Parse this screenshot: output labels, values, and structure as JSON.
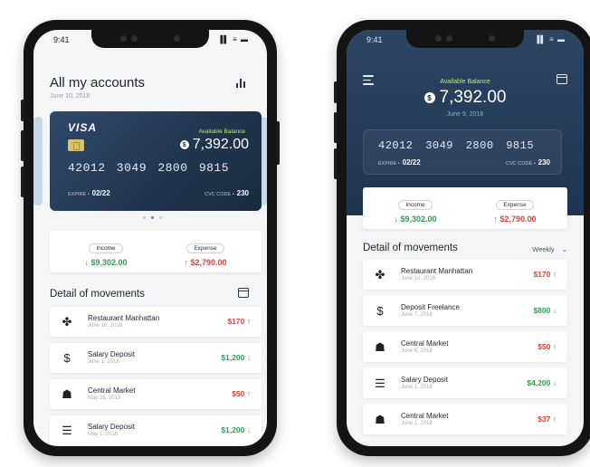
{
  "left_phone": {
    "status_time": "9:41",
    "status_icons": "▐▌ ≡ ▬",
    "title": "All my accounts",
    "date": "June 10, 2018",
    "card": {
      "brand": "VISA",
      "available_label": "Available Balance",
      "currency_symbol": "$",
      "balance": "7,392.00",
      "number": "42012 3049 2800 9815",
      "expire_label": "EXPIRE •",
      "expire_value": "02/22",
      "cvc_label": "CVC CODE •",
      "cvc_value": "230"
    },
    "income_label": "Income",
    "income_value": "$9,302.00",
    "expense_label": "Expense",
    "expense_value": "$2,790.00",
    "section_title": "Detail of movements",
    "movements": [
      {
        "name": "Restaurant Manhattan",
        "date": "June 10, 2018",
        "amount": "$170",
        "arrow": "↑",
        "type": "out",
        "icon": "restaurant-icon",
        "glyph": "✤"
      },
      {
        "name": "Salary Deposit",
        "date": "June 1, 2018",
        "amount": "$1,200",
        "arrow": "↓",
        "type": "in",
        "icon": "money-hand-icon",
        "glyph": "$"
      },
      {
        "name": "Central Market",
        "date": "May 28, 2018",
        "amount": "$50",
        "arrow": "↑",
        "type": "out",
        "icon": "shopping-bag-icon",
        "glyph": "☗"
      },
      {
        "name": "Salary Deposit",
        "date": "May 1, 2018",
        "amount": "$1,200",
        "arrow": "↓",
        "type": "in",
        "icon": "cash-stack-icon",
        "glyph": "☰"
      }
    ]
  },
  "right_phone": {
    "status_time": "9:41",
    "status_icons": "▐▌ ≡ ▬",
    "available_label": "Available Balance",
    "currency_symbol": "$",
    "balance": "7,392.00",
    "date": "June 9, 2018",
    "card": {
      "number": "42012 3049 2800 9815",
      "expire_label": "EXPIRE •",
      "expire_value": "02/22",
      "cvc_label": "CVC CODE •",
      "cvc_value": "230"
    },
    "income_label": "Income",
    "income_value": "$9,302.00",
    "expense_label": "Expense",
    "expense_value": "$2,790.00",
    "section_title": "Detail of movements",
    "filter_value": "Weekly",
    "movements": [
      {
        "name": "Restaurant Manhattan",
        "date": "June 10, 2018",
        "amount": "$170",
        "arrow": "↑",
        "type": "out",
        "icon": "restaurant-icon",
        "glyph": "✤"
      },
      {
        "name": "Deposit Freelance",
        "date": "June 7, 2018",
        "amount": "$800",
        "arrow": "↓",
        "type": "in",
        "icon": "money-hand-icon",
        "glyph": "$"
      },
      {
        "name": "Central Market",
        "date": "June 6, 2018",
        "amount": "$50",
        "arrow": "↑",
        "type": "out",
        "icon": "shopping-bag-icon",
        "glyph": "☗"
      },
      {
        "name": "Salary Deposit",
        "date": "June 1, 2018",
        "amount": "$4,200",
        "arrow": "↓",
        "type": "in",
        "icon": "cash-stack-icon",
        "glyph": "☰"
      },
      {
        "name": "Central Market",
        "date": "June 1, 2018",
        "amount": "$37",
        "arrow": "↑",
        "type": "out",
        "icon": "shopping-bag-icon",
        "glyph": "☗"
      }
    ]
  },
  "colors": {
    "income_green": "#2f9e54",
    "expense_red": "#d8463a",
    "card_navy": "#223650",
    "balance_label_lime": "#c7e27a"
  }
}
